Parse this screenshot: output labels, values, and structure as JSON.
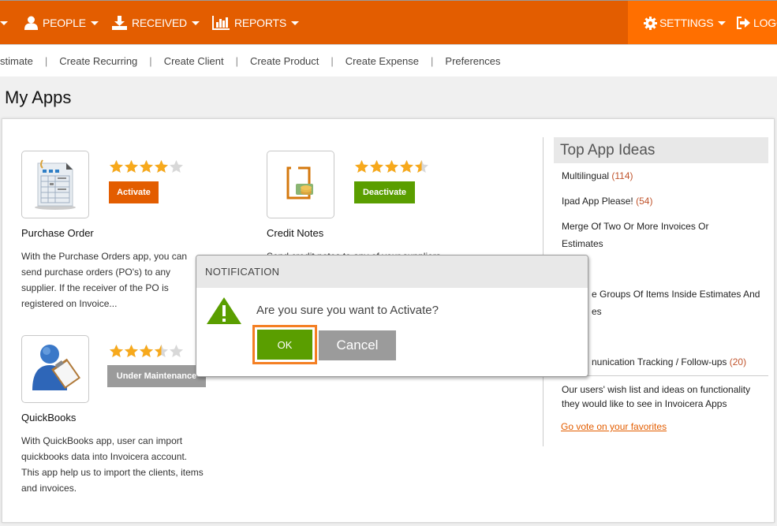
{
  "topnav": {
    "items": [
      {
        "label": "PEOPLE",
        "icon": "user-icon"
      },
      {
        "label": "RECEIVED",
        "icon": "download-icon"
      },
      {
        "label": "REPORTS",
        "icon": "bar-chart-icon"
      }
    ],
    "settings_label": "SETTINGS",
    "logout_label": "LOGO"
  },
  "subnav": {
    "links": [
      "stimate",
      "Create Recurring",
      "Create Client",
      "Create Product",
      "Create Expense",
      "Preferences"
    ],
    "separator": "|"
  },
  "page": {
    "title": "My Apps"
  },
  "apps": [
    {
      "name": "Purchase Order",
      "rating": 4,
      "rating_max": 5,
      "button": "Activate",
      "button_color": "#e35d00",
      "description": "With the Purchase Orders app, you can send purchase orders (PO's) to any supplier. If the receiver of the PO is registered on Invoice..."
    },
    {
      "name": "Credit Notes",
      "rating": 4.5,
      "rating_max": 5,
      "button": "Deactivate",
      "button_color": "#5a9e00",
      "description": "Send credit notes to any of your suppliers"
    },
    {
      "name": "QuickBooks",
      "rating": 3.5,
      "rating_max": 5,
      "button": "Under Maintenance",
      "button_color": "#9b9b9b",
      "description": "With QuickBooks app, user can import quickbooks data into Invoicera account. This app help us to import the clients, items and invoices."
    }
  ],
  "sidebar": {
    "title": "Top App Ideas",
    "ideas": [
      {
        "label": "Multilingual",
        "count": "(114)"
      },
      {
        "label": "Ipad App Please!",
        "count": "(54)"
      },
      {
        "label": "Merge Of Two Or More Invoices Or Estimates",
        "count": ""
      },
      {
        "label": "e Groups Of Items Inside Estimates And es",
        "count": ""
      },
      {
        "label": "nunication Tracking / Follow-ups",
        "count": "(20)"
      }
    ],
    "note": "Our users' wish list and ideas on functionality they would like to see in Invoicera Apps",
    "link": "Go vote on your favorites"
  },
  "dialog": {
    "title": "NOTIFICATION",
    "message": "Are you sure you want to Activate?",
    "ok_label": "OK",
    "cancel_label": "Cancel"
  }
}
